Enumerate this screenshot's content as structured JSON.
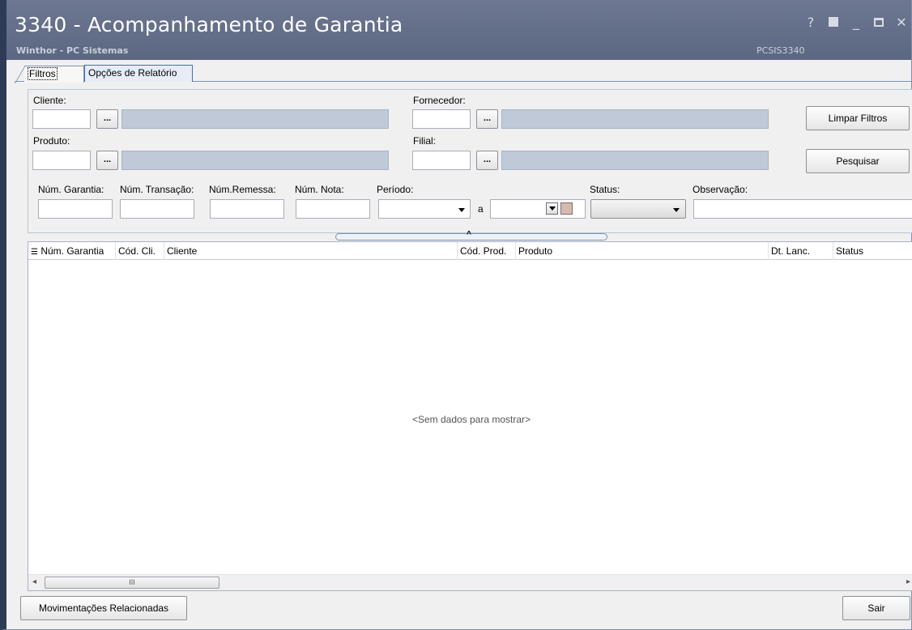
{
  "window": {
    "title": "3340 - Acompanhamento de Garantia",
    "subtitle": "Winthor - PC Sistemas",
    "code": "PCSIS3340",
    "controls": {
      "help": "?",
      "minimize": "_",
      "close": "✕"
    }
  },
  "tabs": [
    {
      "label": "Filtros",
      "active": true
    },
    {
      "label": "Opções de Relatório",
      "active": false
    }
  ],
  "filters": {
    "cliente_label": "Cliente:",
    "fornecedor_label": "Fornecedor:",
    "produto_label": "Produto:",
    "filial_label": "Filial:",
    "dots": "...",
    "limpar_label": "Limpar Filtros",
    "pesquisar_label": "Pesquisar",
    "num_garantia_label": "Núm. Garantia:",
    "num_transacao_label": "Núm. Transação:",
    "num_remessa_label": "Núm.Remessa:",
    "num_nota_label": "Núm. Nota:",
    "periodo_label": "Período:",
    "periodo_sep": "a",
    "status_label": "Status:",
    "observacao_label": "Observação:"
  },
  "grid": {
    "columns": [
      "Núm. Garantia",
      "Cód. Cli.",
      "Cliente",
      "Cód. Prod.",
      "Produto",
      "Dt. Lanc.",
      "Status"
    ],
    "empty_message": "<Sem dados para mostrar>",
    "scroll_thumb": "III"
  },
  "footer": {
    "movimentacoes_label": "Movimentações Relacionadas",
    "sair_label": "Sair"
  },
  "colors": {
    "titlebar": "#6d7791",
    "window_border": "#2e3b57",
    "readonly_field": "#bfc9d8"
  }
}
